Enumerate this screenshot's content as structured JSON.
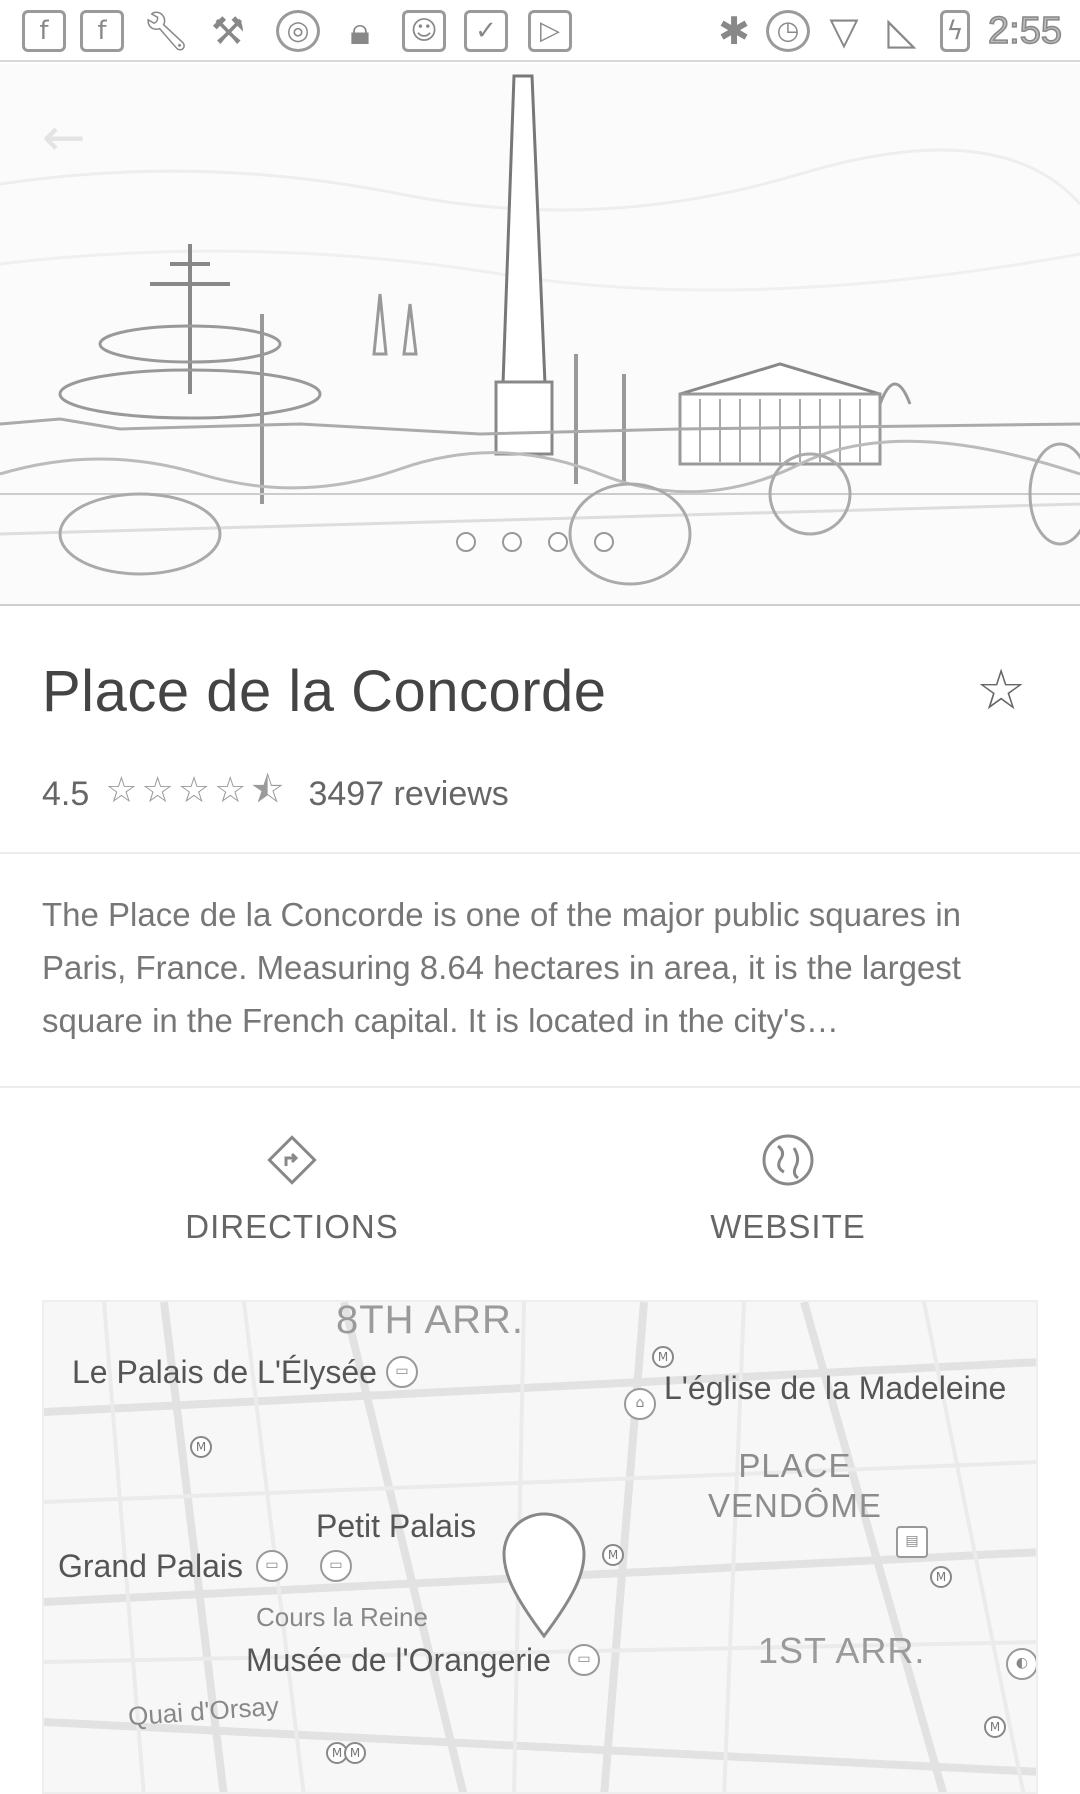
{
  "status_bar": {
    "time": "2:55",
    "left_icons": [
      "facebook-icon",
      "facebook-icon",
      "wrench-icon",
      "tools-icon",
      "circle-icon",
      "lock-icon",
      "android-icon",
      "clipboard-check-icon",
      "play-store-icon"
    ],
    "right_icons": [
      "bluetooth-icon",
      "alarm-icon",
      "wifi-icon",
      "no-signal-icon",
      "battery-charging-icon"
    ]
  },
  "hero": {
    "carousel_dots": 4,
    "active_dot": 0
  },
  "place": {
    "title": "Place de la Concorde",
    "rating": "4.5",
    "stars_filled": 4.5,
    "reviews": "3497 reviews",
    "description": "The Place de la Concorde is one of the major public squares in Paris, France. Measuring 8.64 hectares in area, it is the largest square in the French capital. It is located in the city's…"
  },
  "actions": {
    "directions_label": "DIRECTIONS",
    "website_label": "WEBSITE"
  },
  "map": {
    "labels": {
      "arr8": "8TH ARR.",
      "elysee": "Le Palais de L'Élysée",
      "madeleine": "L'église de la Madeleine",
      "vendome_1": "PLACE",
      "vendome_2": "VENDÔME",
      "petit_palais": "Petit Palais",
      "grand_palais": "Grand Palais",
      "cours_reine": "Cours la Reine",
      "orangerie": "Musée de l'Orangerie",
      "arr1": "1ST ARR.",
      "quai_orsay": "Quai d'Orsay"
    },
    "metro_symbol": "M"
  }
}
